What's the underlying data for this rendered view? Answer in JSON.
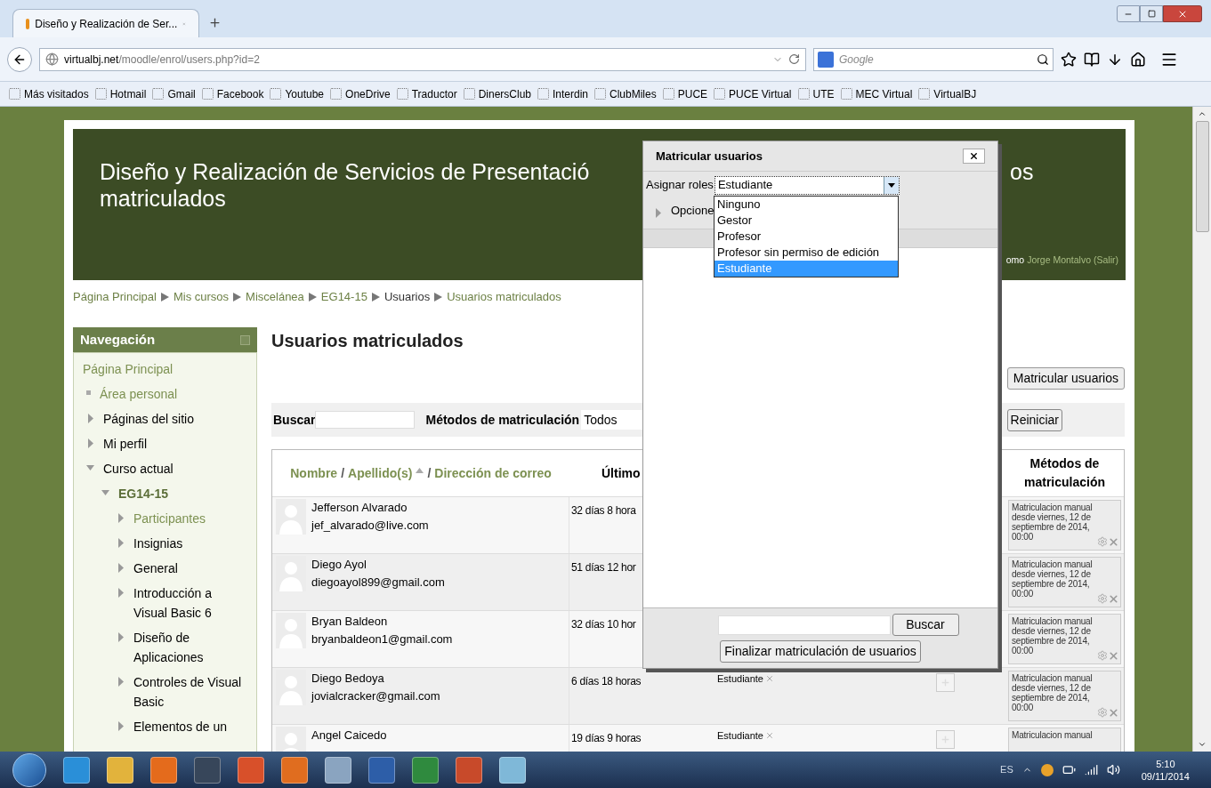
{
  "browser": {
    "tabs": [
      {
        "label": "Diseño y Realización de Ser...",
        "selected": true
      }
    ],
    "url_host": "virtualbj.net",
    "url_path": "/moodle/enrol/users.php?id=2",
    "search_placeholder": "Google",
    "bookmarks": [
      "Más visitados",
      "Hotmail",
      "Gmail",
      "Facebook",
      "Youtube",
      "OneDrive",
      "Traductor",
      "DinersClub",
      "Interdin",
      "ClubMiles",
      "PUCE",
      "PUCE Virtual",
      "UTE",
      "MEC Virtual",
      "VirtualBJ"
    ]
  },
  "page": {
    "title_start": "Diseño y Realización de Servicios de Presentació",
    "title_tail": "os",
    "title_line2": "matriculados",
    "login": {
      "prefix": "omo",
      "user": "Jorge Montalvo",
      "logout": "(Salir)"
    },
    "breadcrumb": [
      {
        "label": "Página Principal",
        "link": true
      },
      {
        "label": "Mis cursos",
        "link": true
      },
      {
        "label": "Miscelánea",
        "link": true
      },
      {
        "label": "EG14-15",
        "link": true
      },
      {
        "label": "Usuarios",
        "link": false
      },
      {
        "label": "Usuarios matriculados",
        "link": true
      }
    ],
    "nav": {
      "title": "Navegación",
      "items": [
        {
          "label": "Página Principal",
          "kind": "home"
        },
        {
          "label": "Área personal",
          "kind": "bullet"
        },
        {
          "label": "Páginas del sitio",
          "kind": "branch",
          "expanded": false
        },
        {
          "label": "Mi perfil",
          "kind": "branch",
          "expanded": false
        },
        {
          "label": "Curso actual",
          "kind": "branch",
          "expanded": true,
          "children": [
            {
              "label": "EG14-15",
              "kind": "course",
              "expanded": true,
              "children": [
                {
                  "label": "Participantes",
                  "kind": "link_branch",
                  "expanded": false
                },
                {
                  "label": "Insignias",
                  "kind": "branch",
                  "expanded": false
                },
                {
                  "label": "General",
                  "kind": "branch",
                  "expanded": false
                },
                {
                  "label": "Introducción a Visual Basic 6",
                  "kind": "branch",
                  "expanded": false
                },
                {
                  "label": "Diseño de Aplicaciones",
                  "kind": "branch",
                  "expanded": false
                },
                {
                  "label": "Controles de Visual Basic",
                  "kind": "branch",
                  "expanded": false
                },
                {
                  "label": "Elementos de un",
                  "kind": "branch",
                  "expanded": false
                }
              ]
            }
          ]
        }
      ]
    },
    "heading": "Usuarios matriculados",
    "enrol_button": "Matricular usuarios",
    "filter": {
      "search_label": "Buscar",
      "methods_label": "Métodos de matriculación",
      "methods_value": "Todos",
      "reset_button": "Reiniciar"
    },
    "table": {
      "name_header": [
        {
          "kind": "link",
          "text": "Nombre"
        },
        {
          "kind": "sep",
          "text": "/"
        },
        {
          "kind": "link",
          "text": "Apellido(s)"
        },
        {
          "kind": "sort"
        },
        {
          "kind": "sep",
          "text": "/"
        },
        {
          "kind": "link",
          "text": "Dirección de correo"
        }
      ],
      "last_header": "Último",
      "methods_header": "Métodos de matriculación",
      "rows": [
        {
          "name": "Jefferson Alvarado",
          "email": "jef_alvarado@live.com",
          "last_access": "32 días 8 hora",
          "roles": [],
          "method": "Matriculacion manual desde viernes, 12 de septiembre de 2014, 00:00"
        },
        {
          "name": "Diego Ayol",
          "email": "diegoayol899@gmail.com",
          "last_access": "51 días 12 hor",
          "roles": [],
          "method": "Matriculacion manual desde viernes, 12 de septiembre de 2014, 00:00"
        },
        {
          "name": "Bryan Baldeon",
          "email": "bryanbaldeon1@gmail.com",
          "last_access": "32 días 10 hor",
          "roles": [],
          "method": "Matriculacion manual desde viernes, 12 de septiembre de 2014, 00:00"
        },
        {
          "name": "Diego Bedoya",
          "email": "jovialcracker@gmail.com",
          "last_access": "6 días 18 horas",
          "roles": [
            "Estudiante"
          ],
          "group_button": true,
          "method": "Matriculacion manual desde viernes, 12 de septiembre de 2014, 00:00"
        },
        {
          "name": "Angel Caicedo",
          "last_access": "19 días 9 horas",
          "roles": [
            "Estudiante"
          ],
          "group_button": true,
          "method": "Matriculacion manual"
        }
      ]
    }
  },
  "dialog": {
    "title": "Matricular usuarios",
    "roles_label": "Asignar roles",
    "role_value": "Estudiante",
    "options_label": "Opcione",
    "options": [
      {
        "label": "Ninguno",
        "selected": false
      },
      {
        "label": "Gestor",
        "selected": false
      },
      {
        "label": "Profesor",
        "selected": false
      },
      {
        "label": "Profesor sin permiso de edición",
        "selected": false
      },
      {
        "label": "Estudiante",
        "selected": true
      }
    ],
    "search_button": "Buscar",
    "finish_button": "Finalizar matriculación de usuarios"
  },
  "taskbar": {
    "language": "ES",
    "time": "5:10",
    "date": "09/11/2014"
  }
}
